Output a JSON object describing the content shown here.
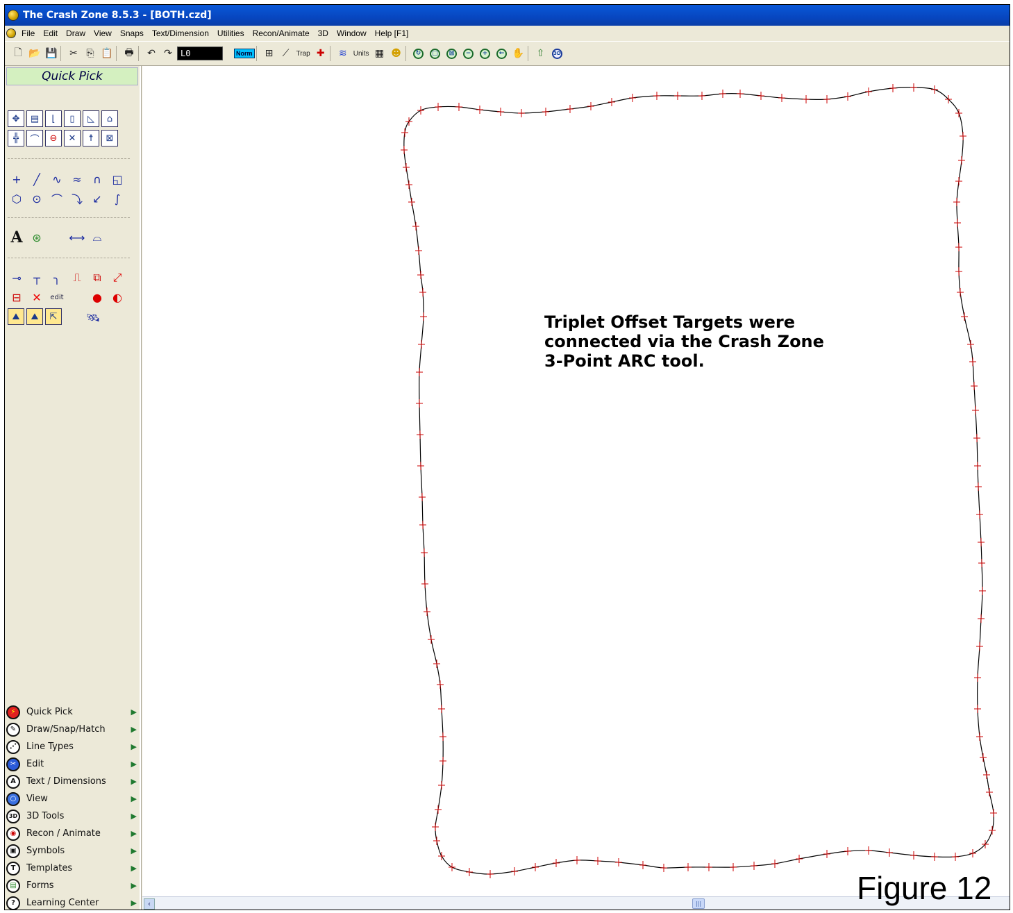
{
  "window": {
    "title": "The Crash Zone 8.5.3  - [BOTH.czd]"
  },
  "menu": [
    "File",
    "Edit",
    "Draw",
    "View",
    "Snaps",
    "Text/Dimension",
    "Utilities",
    "Recon/Animate",
    "3D",
    "Window",
    "Help [F1]"
  ],
  "toolbar": {
    "layer_value": "L0",
    "norm_label": "Norm",
    "trap_label": "Trap",
    "units_label": "Units",
    "zoom_icons": [
      "zoom-all-icon",
      "zoom-window-icon",
      "zoom-extents-icon",
      "zoom-out-icon",
      "zoom-in-icon",
      "zoom-previous-icon",
      "pan-hand-icon"
    ]
  },
  "sidebar": {
    "header": "Quick Pick",
    "text_tool_label": "A",
    "edit_label": "edit",
    "panels": [
      {
        "label": "Quick Pick",
        "icon": "lightning-icon",
        "glyph": "⚡"
      },
      {
        "label": "Draw/Snap/Hatch",
        "icon": "pencil-icon",
        "glyph": "✎"
      },
      {
        "label": "Line Types",
        "icon": "dotted-curve-icon",
        "glyph": "⋰"
      },
      {
        "label": "Edit",
        "icon": "wrench-icon",
        "glyph": "✂"
      },
      {
        "label": "Text / Dimensions",
        "icon": "letter-a-icon",
        "glyph": "A"
      },
      {
        "label": "View",
        "icon": "magnifier-icon",
        "glyph": "○"
      },
      {
        "label": "3D Tools",
        "icon": "3d-icon",
        "glyph": "3D"
      },
      {
        "label": "Recon / Animate",
        "icon": "recon-icon",
        "glyph": "◉"
      },
      {
        "label": "Symbols",
        "icon": "symbols-icon",
        "glyph": "▣"
      },
      {
        "label": "Templates",
        "icon": "letter-t-icon",
        "glyph": "T"
      },
      {
        "label": "Forms",
        "icon": "forms-icon",
        "glyph": "▤"
      },
      {
        "label": "Learning Center",
        "icon": "question-icon",
        "glyph": "?"
      }
    ],
    "panel_camera_glyph": "▶"
  },
  "drawing": {
    "annotation": [
      "Triplet Offset Targets were",
      "connected via the Crash Zone",
      "3-Point ARC tool."
    ],
    "figure_label": "Figure 12",
    "curve_color": "#000000",
    "target_marker_color": "#cc0000"
  }
}
